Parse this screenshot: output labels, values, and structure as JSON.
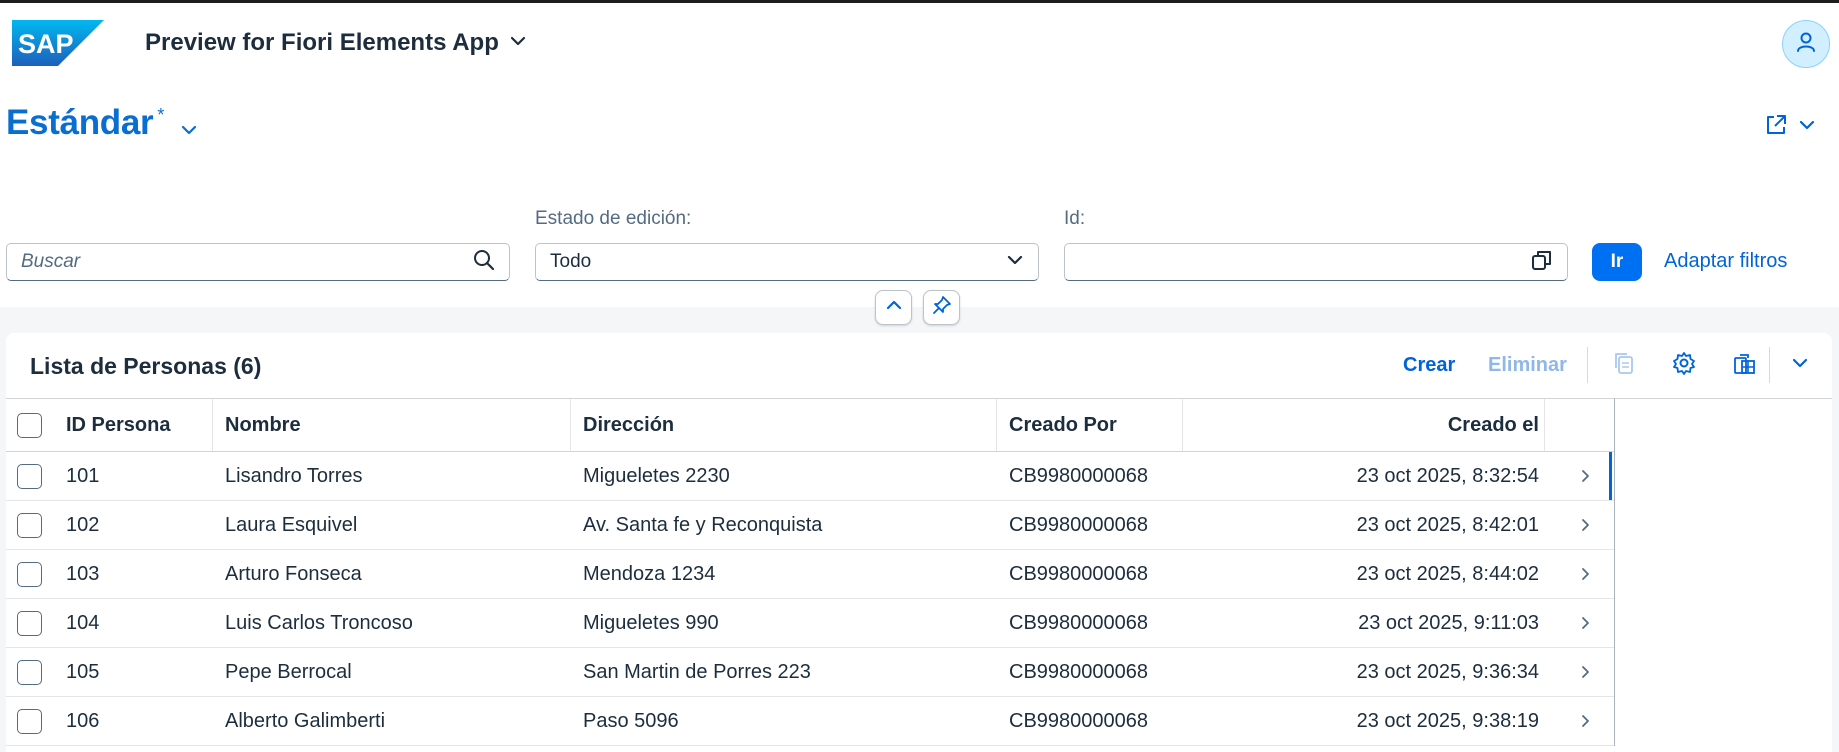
{
  "shell": {
    "logo_text": "SAP",
    "app_title": "Preview for Fiori Elements App",
    "icons": {
      "title_menu": "chevron-down-icon",
      "user": "person-icon"
    }
  },
  "header": {
    "variant_name": "Estándar",
    "variant_modified_marker": "*",
    "icons": {
      "variant_menu": "chevron-down-icon",
      "share": "share-icon",
      "share_menu": "chevron-down-icon"
    }
  },
  "filters": {
    "search": {
      "placeholder": "Buscar",
      "value": ""
    },
    "edit_state": {
      "label": "Estado de edición:",
      "value": "Todo"
    },
    "id": {
      "label": "Id:",
      "value": ""
    },
    "go_label": "Ir",
    "adapt_label": "Adaptar filtros"
  },
  "table": {
    "title": "Lista de Personas (6)",
    "create_label": "Crear",
    "delete_label": "Eliminar",
    "columns": [
      "ID Persona",
      "Nombre",
      "Dirección",
      "Creado Por",
      "Creado el"
    ],
    "rows": [
      {
        "id": "101",
        "name": "Lisandro Torres",
        "address": "Migueletes 2230",
        "created_by": "CB9980000068",
        "created_on": "23 oct 2025, 8:32:54"
      },
      {
        "id": "102",
        "name": "Laura Esquivel",
        "address": "Av. Santa fe y Reconquista",
        "created_by": "CB9980000068",
        "created_on": "23 oct 2025, 8:42:01"
      },
      {
        "id": "103",
        "name": "Arturo Fonseca",
        "address": "Mendoza 1234",
        "created_by": "CB9980000068",
        "created_on": "23 oct 2025, 8:44:02"
      },
      {
        "id": "104",
        "name": "Luis Carlos Troncoso",
        "address": "Migueletes 990",
        "created_by": "CB9980000068",
        "created_on": "23 oct 2025, 9:11:03"
      },
      {
        "id": "105",
        "name": "Pepe Berrocal",
        "address": "San Martin de Porres 223",
        "created_by": "CB9980000068",
        "created_on": "23 oct 2025, 9:36:34"
      },
      {
        "id": "106",
        "name": "Alberto Galimberti",
        "address": "Paso 5096",
        "created_by": "CB9980000068",
        "created_on": "23 oct 2025, 9:38:19"
      }
    ]
  },
  "colors": {
    "brand_blue": "#0a6ed1",
    "button_blue": "#0070f2",
    "link_blue": "#0064d9",
    "disabled_text": "#8fb8e8"
  }
}
